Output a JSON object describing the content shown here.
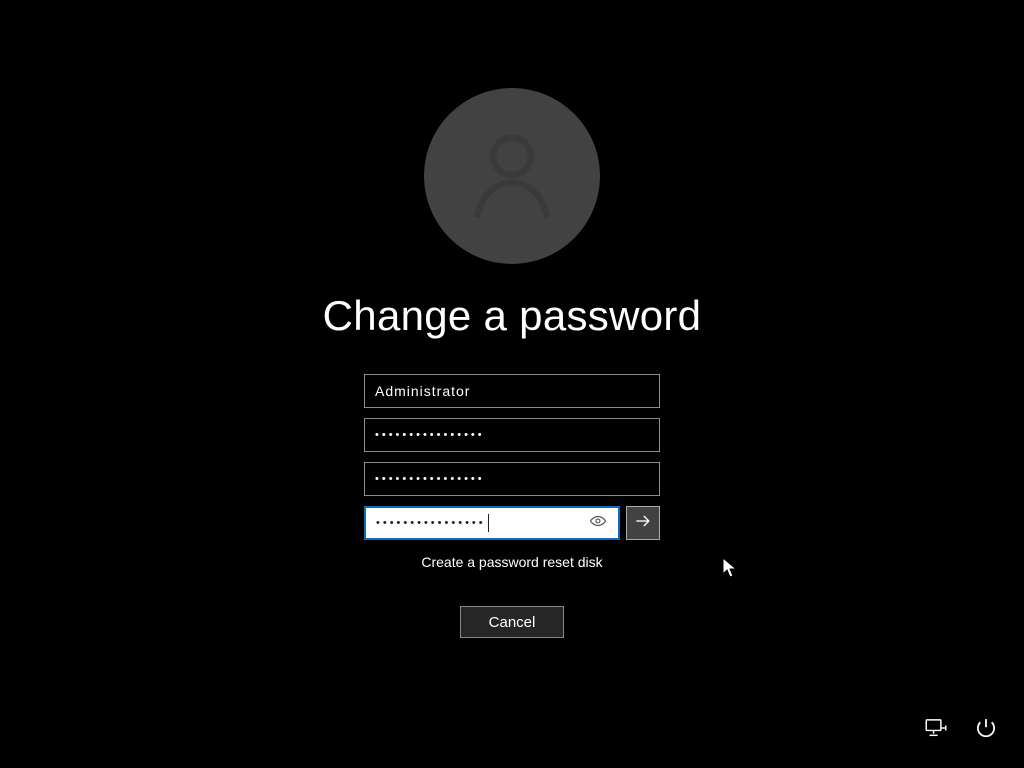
{
  "title": "Change a password",
  "username": "Administrator",
  "old_password_mask": "••••••••••••••••",
  "new_password_mask": "••••••••••••••••",
  "confirm_password_mask": "••••••••••••••••",
  "reset_link": "Create a password reset disk",
  "cancel_label": "Cancel",
  "icons": {
    "avatar": "user-icon",
    "reveal": "eye-icon",
    "submit": "arrow-right-icon",
    "network": "network-icon",
    "power": "power-icon"
  }
}
